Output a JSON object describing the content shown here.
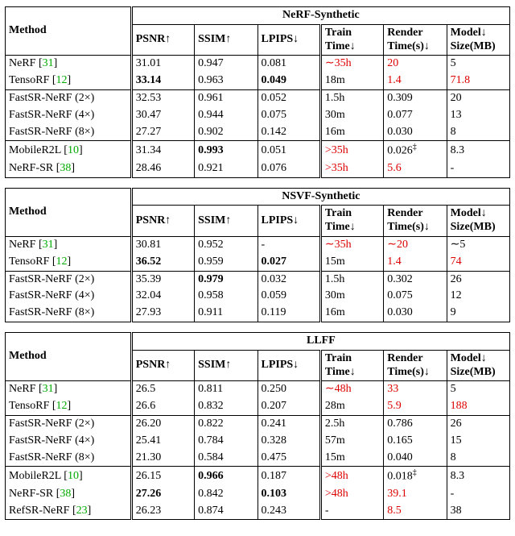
{
  "headers": {
    "method": "Method",
    "psnr": "PSNR↑",
    "ssim": "SSIM↑",
    "lpips": "LPIPS↓",
    "train": "Train Time↓",
    "render": "Render Time(s)↓",
    "size": "Model↓ Size(MB)"
  },
  "tables": [
    {
      "title": "NeRF-Synthetic",
      "groups": [
        [
          {
            "method": "NeRF",
            "cite": "31",
            "psnr": "31.01",
            "ssim": "0.947",
            "lpips": "0.081",
            "train": "∼35h",
            "train_red": true,
            "render": "20",
            "render_red": true,
            "size": "5"
          },
          {
            "method": "TensoRF",
            "cite": "12",
            "psnr": "33.14",
            "psnr_bold": true,
            "ssim": "0.963",
            "lpips": "0.049",
            "lpips_bold": true,
            "train": "18m",
            "render": "1.4",
            "render_red": true,
            "size": "71.8",
            "size_red": true
          }
        ],
        [
          {
            "method": "FastSR-NeRF (2×)",
            "psnr": "32.53",
            "ssim": "0.961",
            "lpips": "0.052",
            "train": "1.5h",
            "render": "0.309",
            "size": "20"
          },
          {
            "method": "FastSR-NeRF (4×)",
            "psnr": "30.47",
            "ssim": "0.944",
            "lpips": "0.075",
            "train": "30m",
            "render": "0.077",
            "size": "13"
          },
          {
            "method": "FastSR-NeRF (8×)",
            "psnr": "27.27",
            "ssim": "0.902",
            "lpips": "0.142",
            "train": "16m",
            "render": "0.030",
            "size": "8"
          }
        ],
        [
          {
            "method": "MobileR2L",
            "cite": "10",
            "psnr": "31.34",
            "ssim": "0.993",
            "ssim_bold": true,
            "lpips": "0.051",
            "train": ">35h",
            "train_red": true,
            "render": "0.026",
            "render_sup": "‡",
            "size": "8.3"
          },
          {
            "method": "NeRF-SR",
            "cite": "38",
            "psnr": "28.46",
            "ssim": "0.921",
            "lpips": "0.076",
            "train": ">35h",
            "train_red": true,
            "render": "5.6",
            "render_red": true,
            "size": "-"
          }
        ]
      ]
    },
    {
      "title": "NSVF-Synthetic",
      "groups": [
        [
          {
            "method": "NeRF",
            "cite": "31",
            "psnr": "30.81",
            "ssim": "0.952",
            "lpips": "-",
            "train": "∼35h",
            "train_red": true,
            "render": "∼20",
            "render_red": true,
            "size": "∼5"
          },
          {
            "method": "TensoRF",
            "cite": "12",
            "psnr": "36.52",
            "psnr_bold": true,
            "ssim": "0.959",
            "lpips": "0.027",
            "lpips_bold": true,
            "train": "15m",
            "render": "1.4",
            "render_red": true,
            "size": "74",
            "size_red": true
          }
        ],
        [
          {
            "method": "FastSR-NeRF (2×)",
            "psnr": "35.39",
            "ssim": "0.979",
            "ssim_bold": true,
            "lpips": "0.032",
            "train": "1.5h",
            "render": "0.302",
            "size": "26"
          },
          {
            "method": "FastSR-NeRF (4×)",
            "psnr": "32.04",
            "ssim": "0.958",
            "lpips": "0.059",
            "train": "30m",
            "render": "0.075",
            "size": "12"
          },
          {
            "method": "FastSR-NeRF (8×)",
            "psnr": "27.93",
            "ssim": "0.911",
            "lpips": "0.119",
            "train": "16m",
            "render": "0.030",
            "size": "9"
          }
        ]
      ]
    },
    {
      "title": "LLFF",
      "groups": [
        [
          {
            "method": "NeRF",
            "cite": "31",
            "psnr": "26.5",
            "ssim": "0.811",
            "lpips": "0.250",
            "train": "∼48h",
            "train_red": true,
            "render": "33",
            "render_red": true,
            "size": "5"
          },
          {
            "method": "TensoRF",
            "cite": "12",
            "psnr": "26.6",
            "ssim": "0.832",
            "lpips": "0.207",
            "train": "28m",
            "render": "5.9",
            "render_red": true,
            "size": "188",
            "size_red": true
          }
        ],
        [
          {
            "method": "FastSR-NeRF (2×)",
            "psnr": "26.20",
            "ssim": "0.822",
            "lpips": "0.241",
            "train": "2.5h",
            "render": "0.786",
            "size": "26"
          },
          {
            "method": "FastSR-NeRF (4×)",
            "psnr": "25.41",
            "ssim": "0.784",
            "lpips": "0.328",
            "train": "57m",
            "render": "0.165",
            "size": "15"
          },
          {
            "method": "FastSR-NeRF (8×)",
            "psnr": "21.30",
            "ssim": "0.584",
            "lpips": "0.475",
            "train": "15m",
            "render": "0.040",
            "size": "8"
          }
        ],
        [
          {
            "method": "MobileR2L",
            "cite": "10",
            "psnr": "26.15",
            "ssim": "0.966",
            "ssim_bold": true,
            "lpips": "0.187",
            "train": ">48h",
            "train_red": true,
            "render": "0.018",
            "render_sup": "‡",
            "size": "8.3"
          },
          {
            "method": "NeRF-SR",
            "cite": "38",
            "psnr": "27.26",
            "psnr_bold": true,
            "ssim": "0.842",
            "lpips": "0.103",
            "lpips_bold": true,
            "train": ">48h",
            "train_red": true,
            "render": "39.1",
            "render_red": true,
            "size": "-"
          },
          {
            "method": "RefSR-NeRF",
            "cite": "23",
            "psnr": "26.23",
            "ssim": "0.874",
            "lpips": "0.243",
            "train": "-",
            "render": "8.5",
            "render_red": true,
            "size": "38"
          }
        ]
      ]
    }
  ],
  "chart_data": [
    {
      "type": "table",
      "title": "NeRF-Synthetic",
      "columns": [
        "Method",
        "PSNR↑",
        "SSIM↑",
        "LPIPS↓",
        "Train Time↓",
        "Render Time(s)↓",
        "Model↓ Size(MB)"
      ],
      "rows": [
        [
          "NeRF [31]",
          31.01,
          0.947,
          0.081,
          "∼35h",
          20,
          5
        ],
        [
          "TensoRF [12]",
          33.14,
          0.963,
          0.049,
          "18m",
          1.4,
          71.8
        ],
        [
          "FastSR-NeRF (2×)",
          32.53,
          0.961,
          0.052,
          "1.5h",
          0.309,
          20
        ],
        [
          "FastSR-NeRF (4×)",
          30.47,
          0.944,
          0.075,
          "30m",
          0.077,
          13
        ],
        [
          "FastSR-NeRF (8×)",
          27.27,
          0.902,
          0.142,
          "16m",
          0.03,
          8
        ],
        [
          "MobileR2L [10]",
          31.34,
          0.993,
          0.051,
          ">35h",
          "0.026‡",
          8.3
        ],
        [
          "NeRF-SR [38]",
          28.46,
          0.921,
          0.076,
          ">35h",
          5.6,
          null
        ]
      ]
    },
    {
      "type": "table",
      "title": "NSVF-Synthetic",
      "columns": [
        "Method",
        "PSNR↑",
        "SSIM↑",
        "LPIPS↓",
        "Train Time↓",
        "Render Time(s)↓",
        "Model↓ Size(MB)"
      ],
      "rows": [
        [
          "NeRF [31]",
          30.81,
          0.952,
          null,
          "∼35h",
          "∼20",
          "∼5"
        ],
        [
          "TensoRF [12]",
          36.52,
          0.959,
          0.027,
          "15m",
          1.4,
          74
        ],
        [
          "FastSR-NeRF (2×)",
          35.39,
          0.979,
          0.032,
          "1.5h",
          0.302,
          26
        ],
        [
          "FastSR-NeRF (4×)",
          32.04,
          0.958,
          0.059,
          "30m",
          0.075,
          12
        ],
        [
          "FastSR-NeRF (8×)",
          27.93,
          0.911,
          0.119,
          "16m",
          0.03,
          9
        ]
      ]
    },
    {
      "type": "table",
      "title": "LLFF",
      "columns": [
        "Method",
        "PSNR↑",
        "SSIM↑",
        "LPIPS↓",
        "Train Time↓",
        "Render Time(s)↓",
        "Model↓ Size(MB)"
      ],
      "rows": [
        [
          "NeRF [31]",
          26.5,
          0.811,
          0.25,
          "∼48h",
          33,
          5
        ],
        [
          "TensoRF [12]",
          26.6,
          0.832,
          0.207,
          "28m",
          5.9,
          188
        ],
        [
          "FastSR-NeRF (2×)",
          26.2,
          0.822,
          0.241,
          "2.5h",
          0.786,
          26
        ],
        [
          "FastSR-NeRF (4×)",
          25.41,
          0.784,
          0.328,
          "57m",
          0.165,
          15
        ],
        [
          "FastSR-NeRF (8×)",
          21.3,
          0.584,
          0.475,
          "15m",
          0.04,
          8
        ],
        [
          "MobileR2L [10]",
          26.15,
          0.966,
          0.187,
          ">48h",
          "0.018‡",
          8.3
        ],
        [
          "NeRF-SR [38]",
          27.26,
          0.842,
          0.103,
          ">48h",
          39.1,
          null
        ],
        [
          "RefSR-NeRF [23]",
          26.23,
          0.874,
          0.243,
          null,
          8.5,
          38
        ]
      ]
    }
  ]
}
